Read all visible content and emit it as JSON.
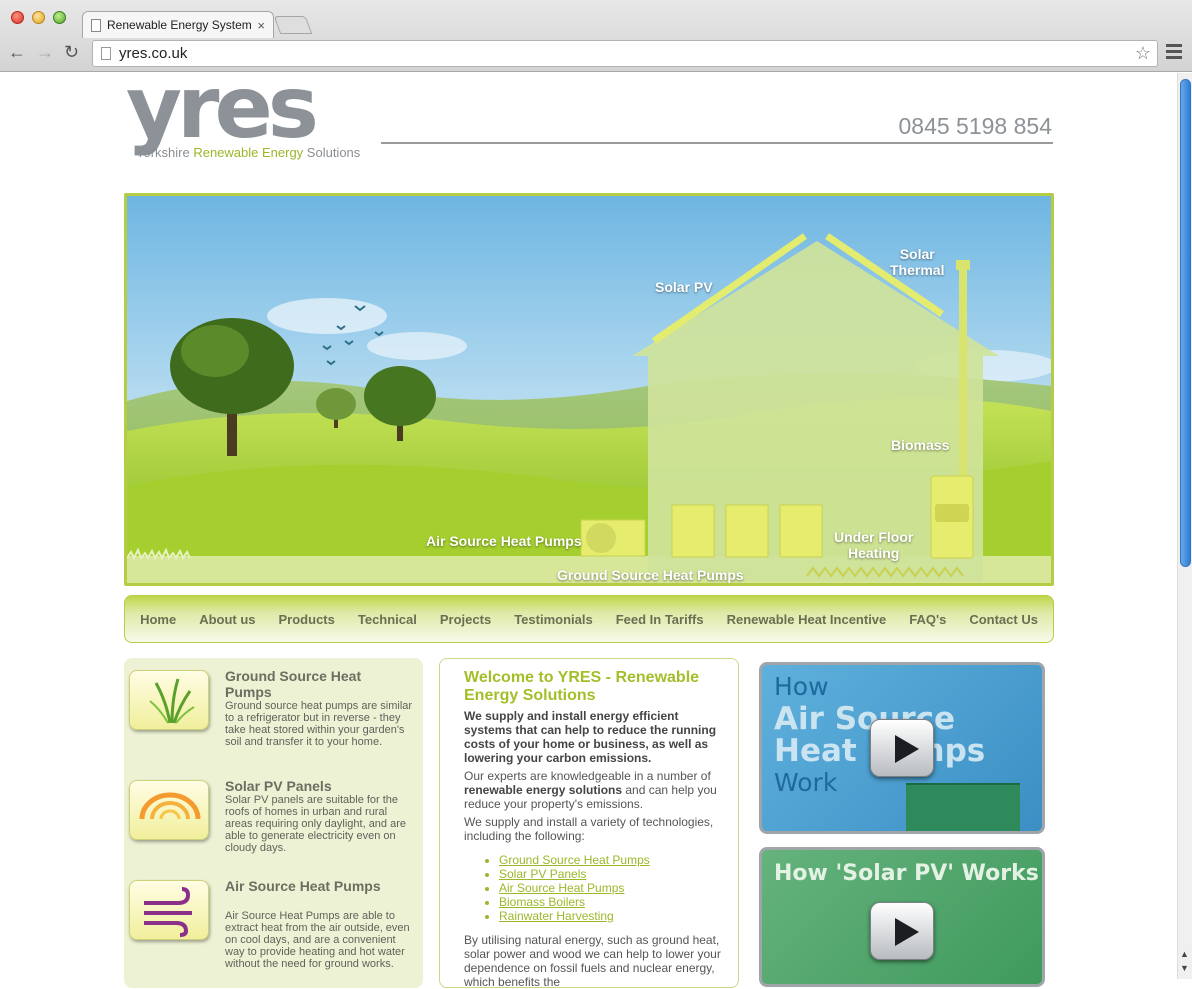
{
  "browser": {
    "tab_title": "Renewable Energy Systems",
    "tab_close": "×",
    "url": "yres.co.uk",
    "back": "←",
    "forward": "→",
    "reload": "↻",
    "star": "☆"
  },
  "header": {
    "logo_word": "yres",
    "logo_tag_pre": "Yorkshire ",
    "logo_tag_hl": "Renewable Energy",
    "logo_tag_post": " Solutions",
    "phone": "0845 5198 854"
  },
  "hero": {
    "labels": {
      "solar_pv": "Solar PV",
      "solar_thermal_1": "Solar",
      "solar_thermal_2": "Thermal",
      "biomass": "Biomass",
      "air_source": "Air Source Heat Pumps",
      "underfloor_1": "Under Floor",
      "underfloor_2": "Heating",
      "ground_source": "Ground Source Heat Pumps"
    }
  },
  "nav": {
    "items": [
      "Home",
      "About us",
      "Products",
      "Technical",
      "Projects",
      "Testimonials",
      "Feed In Tariffs",
      "Renewable Heat Incentive",
      "FAQ's",
      "Contact Us"
    ]
  },
  "technologies": [
    {
      "title": "Ground Source Heat Pumps",
      "description": "Ground source heat pumps are similar to a refrigerator but in reverse - they take heat stored within your garden's soil and transfer it to your home.",
      "icon": "grass-icon"
    },
    {
      "title": "Solar PV Panels",
      "description": "Solar PV panels are suitable for the roofs of homes in urban and rural areas requiring only daylight, and are able to generate electricity even on cloudy days.",
      "icon": "sun-rays-icon"
    },
    {
      "title": "Air Source Heat Pumps",
      "description": "Air Source Heat Pumps are able to extract heat from the air outside, even on cool days, and are a convenient way to provide heating and hot water without the need for ground works.",
      "icon": "wind-icon"
    }
  ],
  "welcome": {
    "title": "Welcome to YRES - Renewable Energy Solutions",
    "intro": "We supply and install energy efficient systems that can help to reduce the running costs of your home or business, as well as lowering your carbon emissions.",
    "p2_pre": "Our experts are knowledgeable in a number of ",
    "p2_bold": "renewable energy solutions",
    "p2_post": " and can help you reduce your property's emissions.",
    "p3": "We supply and install a variety of technologies, including the following:",
    "links": [
      "Ground Source Heat Pumps",
      "Solar PV Panels",
      "Air Source Heat Pumps",
      "Biomass Boilers",
      "Rainwater Harvesting"
    ],
    "p4": "By utilising natural energy, such as ground heat, solar power and wood we can help to lower your dependence on fossil fuels and nuclear energy, which benefits the"
  },
  "videos": [
    {
      "line1": "How",
      "line2": "Air Source",
      "line3": "Heat Pumps",
      "line4": "Work"
    },
    {
      "title": "How 'Solar PV' Works"
    }
  ],
  "colors": {
    "accent_green": "#a2bf2a",
    "nav_gradient_top": "#c0d649",
    "logo_grey": "#8c9297"
  }
}
